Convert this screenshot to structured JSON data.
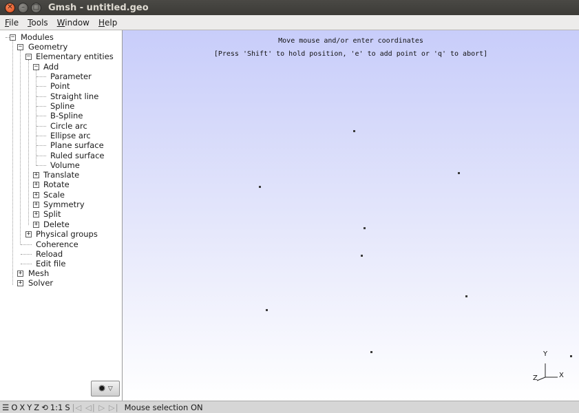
{
  "window": {
    "title": "Gmsh - untitled.geo"
  },
  "menubar": [
    {
      "u": "F",
      "rest": "ile"
    },
    {
      "u": "T",
      "rest": "ools"
    },
    {
      "u": "W",
      "rest": "indow"
    },
    {
      "u": "H",
      "rest": "elp"
    }
  ],
  "tree": {
    "modules": "Modules",
    "geometry": "Geometry",
    "elementary": "Elementary entities",
    "add": "Add",
    "add_items": [
      "Parameter",
      "Point",
      "Straight line",
      "Spline",
      "B-Spline",
      "Circle arc",
      "Ellipse arc",
      "Plane surface",
      "Ruled surface",
      "Volume"
    ],
    "ops": [
      "Translate",
      "Rotate",
      "Scale",
      "Symmetry",
      "Split",
      "Delete"
    ],
    "physical": "Physical groups",
    "geo_leaf": [
      "Coherence",
      "Reload",
      "Edit file"
    ],
    "mesh": "Mesh",
    "solver": "Solver"
  },
  "graphics": {
    "message1": "Move mouse and/or enter coordinates",
    "message2": "[Press 'Shift' to hold position, 'e' to add point or 'q' to abort]",
    "axes": {
      "y": "Y",
      "x": "X",
      "z": "Z"
    }
  },
  "statusbar": {
    "icons": "☰",
    "o": "O",
    "x": "X",
    "y": "Y",
    "z": "Z",
    "rot": "⟲",
    "scale": "1:1",
    "s": "S",
    "anim": "|◁ ◁| ▷ ▷|",
    "message": "Mouse selection ON"
  }
}
